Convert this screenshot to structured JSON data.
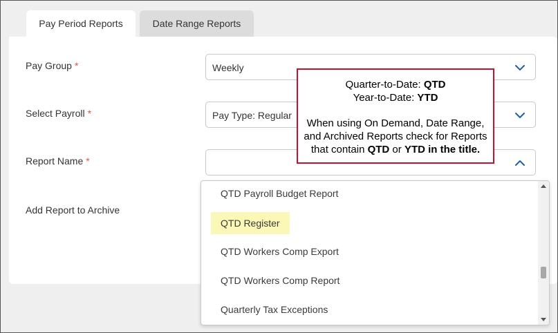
{
  "tabs": {
    "pay_period": "Pay Period Reports",
    "date_range": "Date Range Reports"
  },
  "form": {
    "pay_group_label": "Pay Group",
    "select_payroll_label": "Select Payroll",
    "report_name_label": "Report Name",
    "archive_label": "Add Report to Archive",
    "required_mark": "*",
    "pay_group_value": "Weekly",
    "select_payroll_value": "Pay Type: Regular",
    "report_name_value": ""
  },
  "dropdown": {
    "options": [
      "QTD Payroll Budget Report",
      "QTD Register",
      "QTD Workers Comp Export",
      "QTD Workers Comp Report",
      "Quarterly Tax Exceptions"
    ],
    "highlighted_index": 1
  },
  "note": {
    "line1_prefix": "Quarter-to-Date: ",
    "line1_bold": "QTD",
    "line2_prefix": "Year-to-Date: ",
    "line2_bold": "YTD",
    "para_line1": "When using On Demand, Date Range,",
    "para_line2": "and Archived Reports check for Reports",
    "para_line3_prefix": "that contain ",
    "para_line3_bold1": "QTD",
    "para_line3_mid": " or ",
    "para_line3_bold2": "YTD in the title."
  },
  "colors": {
    "required": "#d9534f",
    "chevron": "#1f5fa8",
    "note_border": "#c8102e",
    "highlight": "#fbf7b6"
  }
}
